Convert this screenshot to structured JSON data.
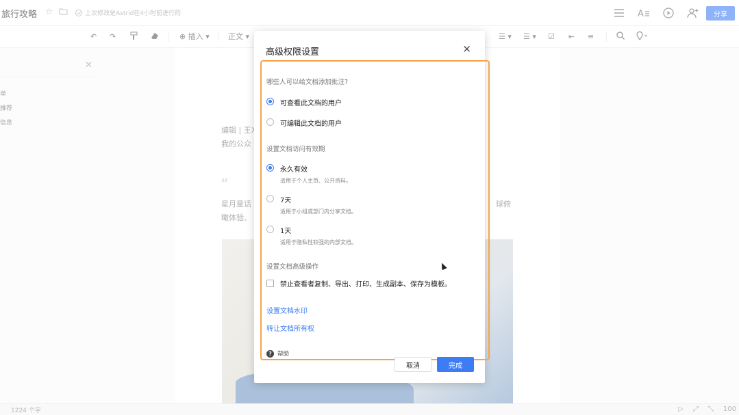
{
  "app": {
    "doc_title": "旅行攻略",
    "save_status": "上次修改是Astrid在4小时前进行的",
    "share_label": "分享",
    "toolbar": {
      "insert_label": "插入",
      "style_label": "正文"
    },
    "side_panel": {
      "items": [
        "单",
        "推荐",
        "信息"
      ]
    },
    "doc": {
      "byline": "编辑 | 王X",
      "line2": "我的公众",
      "para_left_1": "星月童话",
      "para_right_1": "球俯",
      "para_left_2": "瞰体验、"
    },
    "statusbar": {
      "word_count": "1224 个字",
      "zoom": "100"
    }
  },
  "modal": {
    "title": "高级权限设置",
    "comment_section_label": "哪些人可以给文档添加批注?",
    "comment_options": [
      {
        "label": "可查看此文档的用户",
        "checked": true
      },
      {
        "label": "可编辑此文档的用户",
        "checked": false
      }
    ],
    "validity_section_label": "设置文档访问有效期",
    "validity_options": [
      {
        "label": "永久有效",
        "desc": "适用于个人主页、公开资料。",
        "checked": true
      },
      {
        "label": "7天",
        "desc": "适用于小组或部门内分享文档。",
        "checked": false
      },
      {
        "label": "1天",
        "desc": "适用于隐私性较强的内部文档。",
        "checked": false
      }
    ],
    "advanced_section_label": "设置文档高级操作",
    "advanced_checkbox_label": "禁止查看者复制、导出、打印、生成副本、保存为模板。",
    "watermark_link": "设置文档水印",
    "transfer_link": "转让文档所有权",
    "help_label": "帮助",
    "cancel_label": "取消",
    "done_label": "完成"
  },
  "colors": {
    "accent": "#3d7cf4",
    "highlight_border": "#f6a34a"
  }
}
